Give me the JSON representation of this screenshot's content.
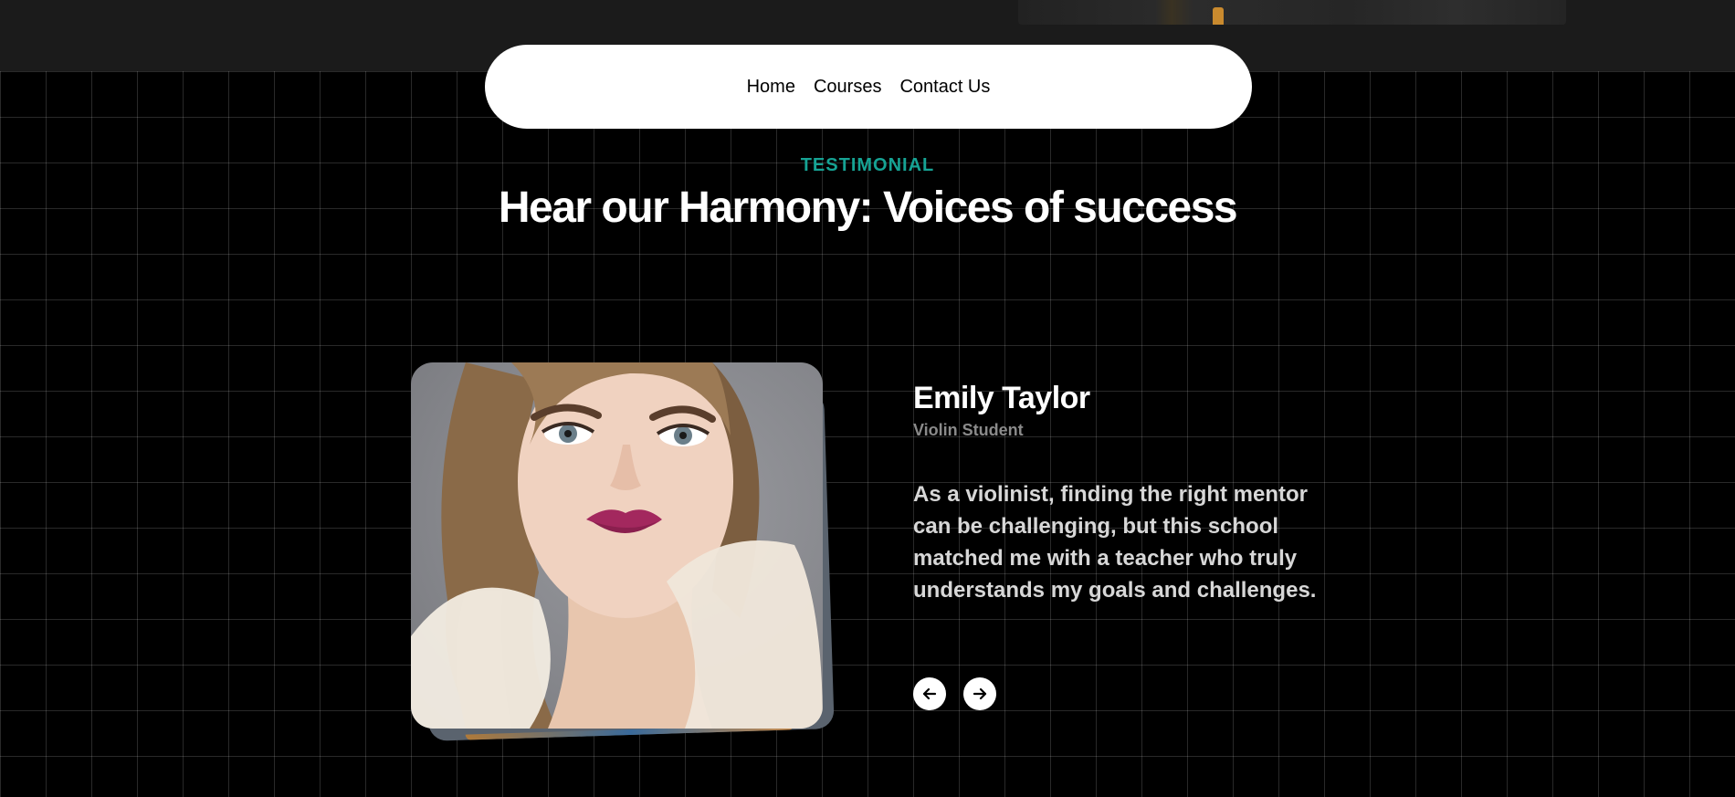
{
  "nav": {
    "items": [
      {
        "label": "Home"
      },
      {
        "label": "Courses"
      },
      {
        "label": "Contact Us"
      }
    ]
  },
  "section": {
    "eyebrow": "TESTIMONIAL",
    "headline": "Hear our Harmony: Voices of success"
  },
  "testimonial": {
    "name": "Emily Taylor",
    "role": "Violin Student",
    "quote": "As a violinist, finding the right mentor can be challenging, but this school matched me with a teacher who truly understands my goals and challenges.",
    "photo_alt": "Emily Taylor portrait"
  },
  "controls": {
    "prev_icon": "arrow-left-icon",
    "next_icon": "arrow-right-icon"
  },
  "colors": {
    "background": "#000000",
    "accent": "#16a394",
    "nav_bg": "#ffffff",
    "text_primary": "#ffffff",
    "text_muted": "#8a8a8a",
    "quote_text": "#d7d7d7"
  }
}
